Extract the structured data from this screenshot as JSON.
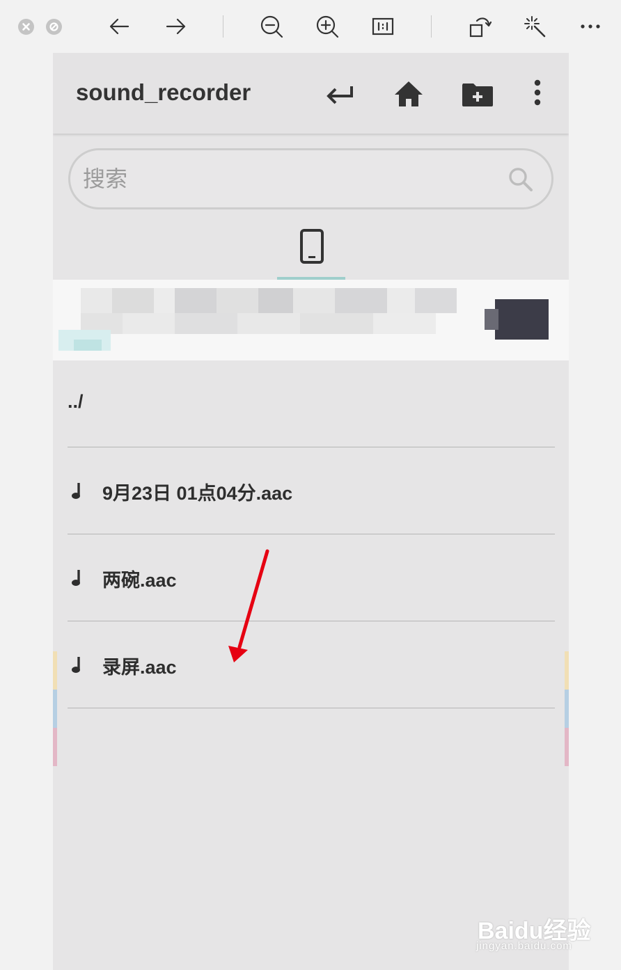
{
  "viewer": {
    "icons": [
      "close-icon",
      "block-icon",
      "back-arrow-icon",
      "forward-arrow-icon",
      "zoom-out-icon",
      "zoom-in-icon",
      "actual-size-icon",
      "rotate-icon",
      "magic-wand-icon",
      "more-icon"
    ]
  },
  "app": {
    "title": "sound_recorder",
    "actions": [
      "return-icon",
      "home-icon",
      "new-folder-icon",
      "overflow-menu-icon"
    ]
  },
  "search": {
    "placeholder": "搜索"
  },
  "tabs": {
    "selected": "phone-storage",
    "indicator_color": "#9fcfcc"
  },
  "files": {
    "parent": "../",
    "items": [
      {
        "name": "9月23日 01点04分.aac",
        "icon": "music-note-icon"
      },
      {
        "name": "两碗.aac",
        "icon": "music-note-icon"
      },
      {
        "name": "录屏.aac",
        "icon": "music-note-icon"
      }
    ]
  },
  "colors": {
    "screen_bg": "#e6e5e6",
    "text": "#2e2e2e",
    "annotation_arrow": "#e60012",
    "edge_yellow": "#f1dfb5",
    "edge_blue": "#b6cfe3",
    "edge_pink": "#e3b7c6"
  },
  "watermark": {
    "brand": "Baidu经验",
    "site": "jingyan.baidu.com"
  }
}
